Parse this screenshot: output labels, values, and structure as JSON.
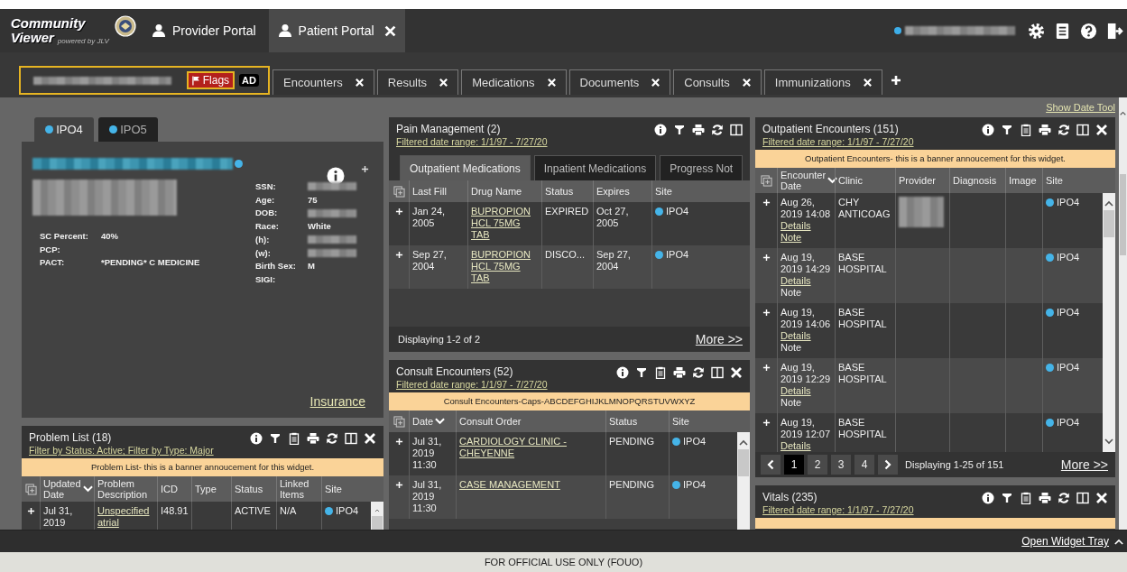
{
  "header": {
    "logo_top": "Community",
    "logo_bottom": "Viewer",
    "logo_tagline": "powered by JLV",
    "portals": [
      {
        "label": "Provider Portal",
        "selected": false,
        "closable": false
      },
      {
        "label": "Patient Portal",
        "selected": true,
        "closable": true
      }
    ]
  },
  "patient_bar": {
    "selected": true,
    "flags": "Flags",
    "badge": "AD",
    "tabs": [
      {
        "label": "Encounters",
        "selected": false
      },
      {
        "label": "Results",
        "selected": false
      },
      {
        "label": "Medications",
        "selected": false
      },
      {
        "label": "Documents",
        "selected": false
      },
      {
        "label": "Consults",
        "selected": false
      },
      {
        "label": "Immunizations",
        "selected": false
      }
    ]
  },
  "show_date_tool": "Show Date Tool",
  "patient_card": {
    "tabs": [
      {
        "label": "IPO4",
        "selected": true
      },
      {
        "label": "IPO5",
        "selected": false
      }
    ],
    "left_fields": [
      {
        "label": "SC Percent:",
        "value": "40%",
        "redacted": false
      },
      {
        "label": "PCP:",
        "redacted": false
      },
      {
        "label": "PACT:",
        "value": "*PENDING* C MEDICINE",
        "redacted": false
      }
    ],
    "right_fields": [
      {
        "label": "SSN:",
        "redacted": true
      },
      {
        "label": "Age:",
        "value": "75",
        "redacted": false
      },
      {
        "label": "DOB:",
        "redacted": true
      },
      {
        "label": "Race:",
        "value": "White",
        "redacted": false
      },
      {
        "label": "(h):",
        "redacted": true
      },
      {
        "label": "(w):",
        "redacted": true
      },
      {
        "label": "Birth Sex:",
        "value": "M",
        "redacted": false
      },
      {
        "label": "SIGI:",
        "redacted": false
      }
    ],
    "insurance": "Insurance"
  },
  "widgets": {
    "problem_list": {
      "title": "Problem List (18)",
      "filter": "Filter by Status: Active; Filter by Type: Major",
      "tools": [
        {
          "kind": "info"
        },
        {
          "kind": "filter"
        },
        {
          "kind": "clipboard"
        },
        {
          "kind": "print"
        },
        {
          "kind": "refresh"
        },
        {
          "kind": "columns"
        },
        {
          "kind": "close"
        }
      ],
      "banner": "Problem List- this is a banner annoucement for this widget.",
      "scrollbar": true,
      "columns": [
        {
          "label": "Updated Date",
          "sorted": true
        },
        {
          "label": "Problem Description",
          "sorted": false
        },
        {
          "label": "ICD",
          "sorted": false
        },
        {
          "label": "Type",
          "sorted": false
        },
        {
          "label": "Status",
          "sorted": false
        },
        {
          "label": "Linked Items",
          "sorted": false
        },
        {
          "label": "Site",
          "sorted": false
        }
      ],
      "rows": [
        {
          "cells": [
            {
              "kind": "text",
              "text": "Jul 31, 2019"
            },
            {
              "kind": "link",
              "text": "Unspecified atrial"
            },
            {
              "kind": "text",
              "text": "I48.91"
            },
            {
              "kind": "empty"
            },
            {
              "kind": "text",
              "text": "ACTIVE"
            },
            {
              "kind": "text",
              "text": "N/A"
            },
            {
              "kind": "site",
              "text": "IPO4"
            }
          ]
        }
      ]
    },
    "pain_management": {
      "title": "Pain Management (2)",
      "filter": "Filtered date range: 1/1/97 - 7/27/20",
      "tools": [
        {
          "kind": "info"
        },
        {
          "kind": "filter"
        },
        {
          "kind": "print"
        },
        {
          "kind": "refresh"
        },
        {
          "kind": "columns"
        }
      ],
      "scrollbar": false,
      "tabs": [
        {
          "label": "Outpatient Medications",
          "selected": true
        },
        {
          "label": "Inpatient Medications",
          "selected": false
        },
        {
          "label": "Progress Not",
          "selected": false
        }
      ],
      "columns": [
        {
          "label": "Last Fill",
          "sorted": false
        },
        {
          "label": "Drug Name",
          "sorted": false
        },
        {
          "label": "Status",
          "sorted": false
        },
        {
          "label": "Expires",
          "sorted": false
        },
        {
          "label": "Site",
          "sorted": false
        }
      ],
      "rows": [
        {
          "cells": [
            {
              "kind": "text",
              "text": "Jan 24, 2005"
            },
            {
              "kind": "link",
              "text": "BUPROPION HCL 75MG TAB"
            },
            {
              "kind": "text",
              "text": "EXPIRED"
            },
            {
              "kind": "text",
              "text": "Oct 27, 2005"
            },
            {
              "kind": "site",
              "text": "IPO4"
            }
          ]
        },
        {
          "cells": [
            {
              "kind": "text",
              "text": "Sep 27, 2004"
            },
            {
              "kind": "link",
              "text": "BUPROPION HCL 75MG TAB"
            },
            {
              "kind": "text",
              "text": "DISCO..."
            },
            {
              "kind": "text",
              "text": "Sep 27, 2004"
            },
            {
              "kind": "site",
              "text": "IPO4"
            }
          ]
        }
      ],
      "footer": {
        "displaying": "Displaying 1-2 of 2",
        "more": "More >>"
      }
    },
    "consult_encounters": {
      "title": "Consult Encounters (52)",
      "filter": "Filtered date range: 1/1/97 - 7/27/20",
      "tools": [
        {
          "kind": "info"
        },
        {
          "kind": "filter"
        },
        {
          "kind": "clipboard"
        },
        {
          "kind": "print"
        },
        {
          "kind": "refresh"
        },
        {
          "kind": "columns"
        },
        {
          "kind": "close"
        }
      ],
      "banner": "Consult Encounters-Caps-ABCDEFGHIJKLMNOPQRSTUVWXYZ",
      "scrollbar": true,
      "columns": [
        {
          "label": "Date",
          "sorted": true
        },
        {
          "label": "Consult Order",
          "sorted": false
        },
        {
          "label": "Status",
          "sorted": false
        },
        {
          "label": "Site",
          "sorted": false
        }
      ],
      "rows": [
        {
          "cells": [
            {
              "kind": "text",
              "text": "Jul 31, 2019 11:30"
            },
            {
              "kind": "link",
              "text": "CARDIOLOGY CLINIC - CHEYENNE"
            },
            {
              "kind": "text",
              "text": "PENDING"
            },
            {
              "kind": "site",
              "text": "IPO4"
            }
          ]
        },
        {
          "cells": [
            {
              "kind": "text",
              "text": "Jul 31, 2019 11:30"
            },
            {
              "kind": "link",
              "text": "CASE MANAGEMENT"
            },
            {
              "kind": "text",
              "text": "PENDING"
            },
            {
              "kind": "site",
              "text": "IPO4"
            }
          ]
        }
      ]
    },
    "outpatient_encounters": {
      "title": "Outpatient Encounters (151)",
      "filter": "Filtered date range: 1/1/97 - 7/27/20",
      "tools": [
        {
          "kind": "info"
        },
        {
          "kind": "filter"
        },
        {
          "kind": "clipboard"
        },
        {
          "kind": "print"
        },
        {
          "kind": "refresh"
        },
        {
          "kind": "columns"
        },
        {
          "kind": "close"
        }
      ],
      "banner": "Outpatient Encounters- this is a banner annoucement for this widget.",
      "scrollbar": true,
      "columns": [
        {
          "label": "Encounter Date",
          "sorted": true
        },
        {
          "label": "Clinic",
          "sorted": false
        },
        {
          "label": "Provider",
          "sorted": false
        },
        {
          "label": "Diagnosis",
          "sorted": false
        },
        {
          "label": "Image",
          "sorted": false
        },
        {
          "label": "Site",
          "sorted": false
        }
      ],
      "rows": [
        {
          "cells": [
            {
              "kind": "stack",
              "lines": [
                {
                  "text": "Aug 26, 2019 14:08",
                  "link": false
                },
                {
                  "text": "Details",
                  "link": true
                },
                {
                  "text": "Note",
                  "link": true
                }
              ]
            },
            {
              "kind": "text",
              "text": "CHY ANTICOAG"
            },
            {
              "kind": "redacted"
            },
            {
              "kind": "empty"
            },
            {
              "kind": "empty"
            },
            {
              "kind": "site",
              "text": "IPO4"
            }
          ]
        },
        {
          "cells": [
            {
              "kind": "stack",
              "lines": [
                {
                  "text": "Aug 19, 2019 14:29",
                  "link": false
                },
                {
                  "text": "Details",
                  "link": true
                },
                {
                  "text": "Note",
                  "link": false
                }
              ]
            },
            {
              "kind": "text",
              "text": "BASE HOSPITAL"
            },
            {
              "kind": "empty"
            },
            {
              "kind": "empty"
            },
            {
              "kind": "empty"
            },
            {
              "kind": "site",
              "text": "IPO4"
            }
          ]
        },
        {
          "cells": [
            {
              "kind": "stack",
              "lines": [
                {
                  "text": "Aug 19, 2019 14:06",
                  "link": false
                },
                {
                  "text": "Details",
                  "link": true
                },
                {
                  "text": "Note",
                  "link": false
                }
              ]
            },
            {
              "kind": "text",
              "text": "BASE HOSPITAL"
            },
            {
              "kind": "empty"
            },
            {
              "kind": "empty"
            },
            {
              "kind": "empty"
            },
            {
              "kind": "site",
              "text": "IPO4"
            }
          ]
        },
        {
          "cells": [
            {
              "kind": "stack",
              "lines": [
                {
                  "text": "Aug 19, 2019 12:29",
                  "link": false
                },
                {
                  "text": "Details",
                  "link": true
                },
                {
                  "text": "Note",
                  "link": false
                }
              ]
            },
            {
              "kind": "text",
              "text": "BASE HOSPITAL"
            },
            {
              "kind": "empty"
            },
            {
              "kind": "empty"
            },
            {
              "kind": "empty"
            },
            {
              "kind": "site",
              "text": "IPO4"
            }
          ]
        },
        {
          "cells": [
            {
              "kind": "stack",
              "lines": [
                {
                  "text": "Aug 19, 2019 12:07",
                  "link": false
                },
                {
                  "text": "Details",
                  "link": true
                }
              ]
            },
            {
              "kind": "text",
              "text": "BASE HOSPITAL"
            },
            {
              "kind": "empty"
            },
            {
              "kind": "empty"
            },
            {
              "kind": "empty"
            },
            {
              "kind": "site",
              "text": "IPO4"
            }
          ]
        }
      ],
      "footer": {
        "pages": [
          {
            "label": "1",
            "selected": true
          },
          {
            "label": "2",
            "selected": false
          },
          {
            "label": "3",
            "selected": false
          },
          {
            "label": "4",
            "selected": false
          }
        ],
        "displaying": "Displaying 1-25 of 151",
        "more": "More >>"
      }
    },
    "vitals": {
      "title": "Vitals (235)",
      "filter": "Filtered date range: 1/1/97 - 7/27/20",
      "tools": [
        {
          "kind": "info"
        },
        {
          "kind": "filter"
        },
        {
          "kind": "clipboard"
        },
        {
          "kind": "print"
        },
        {
          "kind": "refresh"
        },
        {
          "kind": "columns"
        },
        {
          "kind": "close"
        }
      ],
      "banner_partial": true
    }
  },
  "widget_tray": "Open Widget Tray",
  "footer": "FOR OFFICIAL USE ONLY (FOUO)"
}
